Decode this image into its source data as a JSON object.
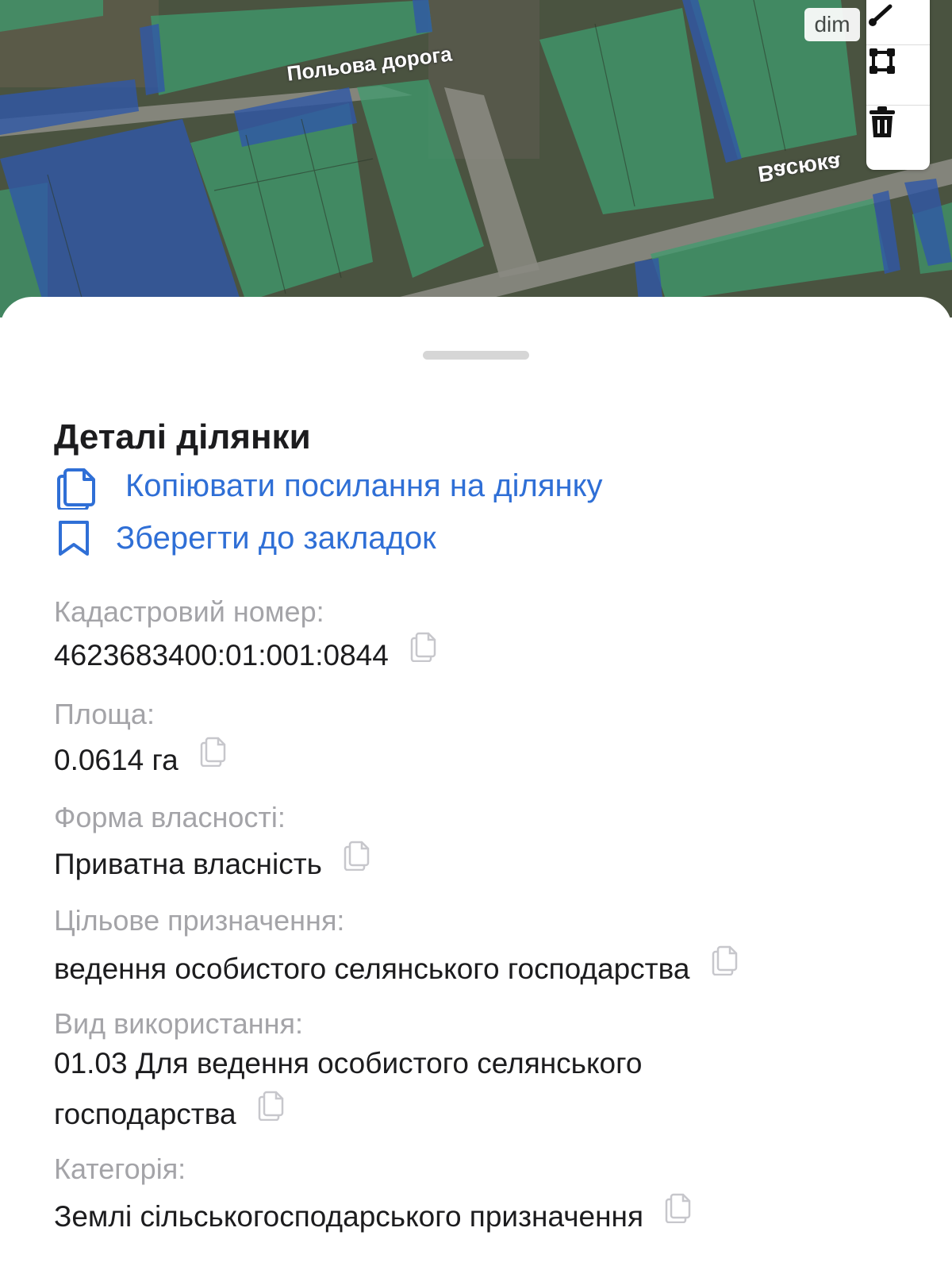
{
  "map": {
    "road_labels": [
      "Польова дорога",
      "Васюка"
    ],
    "badge": "dim",
    "tools": [
      "measure-icon",
      "polygon-icon",
      "trash-icon"
    ],
    "colors": {
      "parcel_green": "#3f9b6e",
      "parcel_blue": "#2f57a8"
    }
  },
  "sheet": {
    "title": "Деталі ділянки",
    "actions": {
      "copy_link": "Копіювати посилання на ділянку",
      "bookmark": "Зберегти до закладок"
    },
    "fields": [
      {
        "label": "Кадастровий номер:",
        "value": "4623683400:01:001:0844"
      },
      {
        "label": "Площа:",
        "value": "0.0614 га"
      },
      {
        "label": "Форма власності:",
        "value": "Приватна власність"
      },
      {
        "label": "Цільове призначення:",
        "value": "ведення особистого селянського господарства"
      },
      {
        "label": "Вид використання:",
        "value": "01.03 Для ведення особистого селянського господарства"
      },
      {
        "label": "Категорія:",
        "value": "Землі сільськогосподарського призначення"
      }
    ],
    "accent_color": "#2f6fd6"
  }
}
